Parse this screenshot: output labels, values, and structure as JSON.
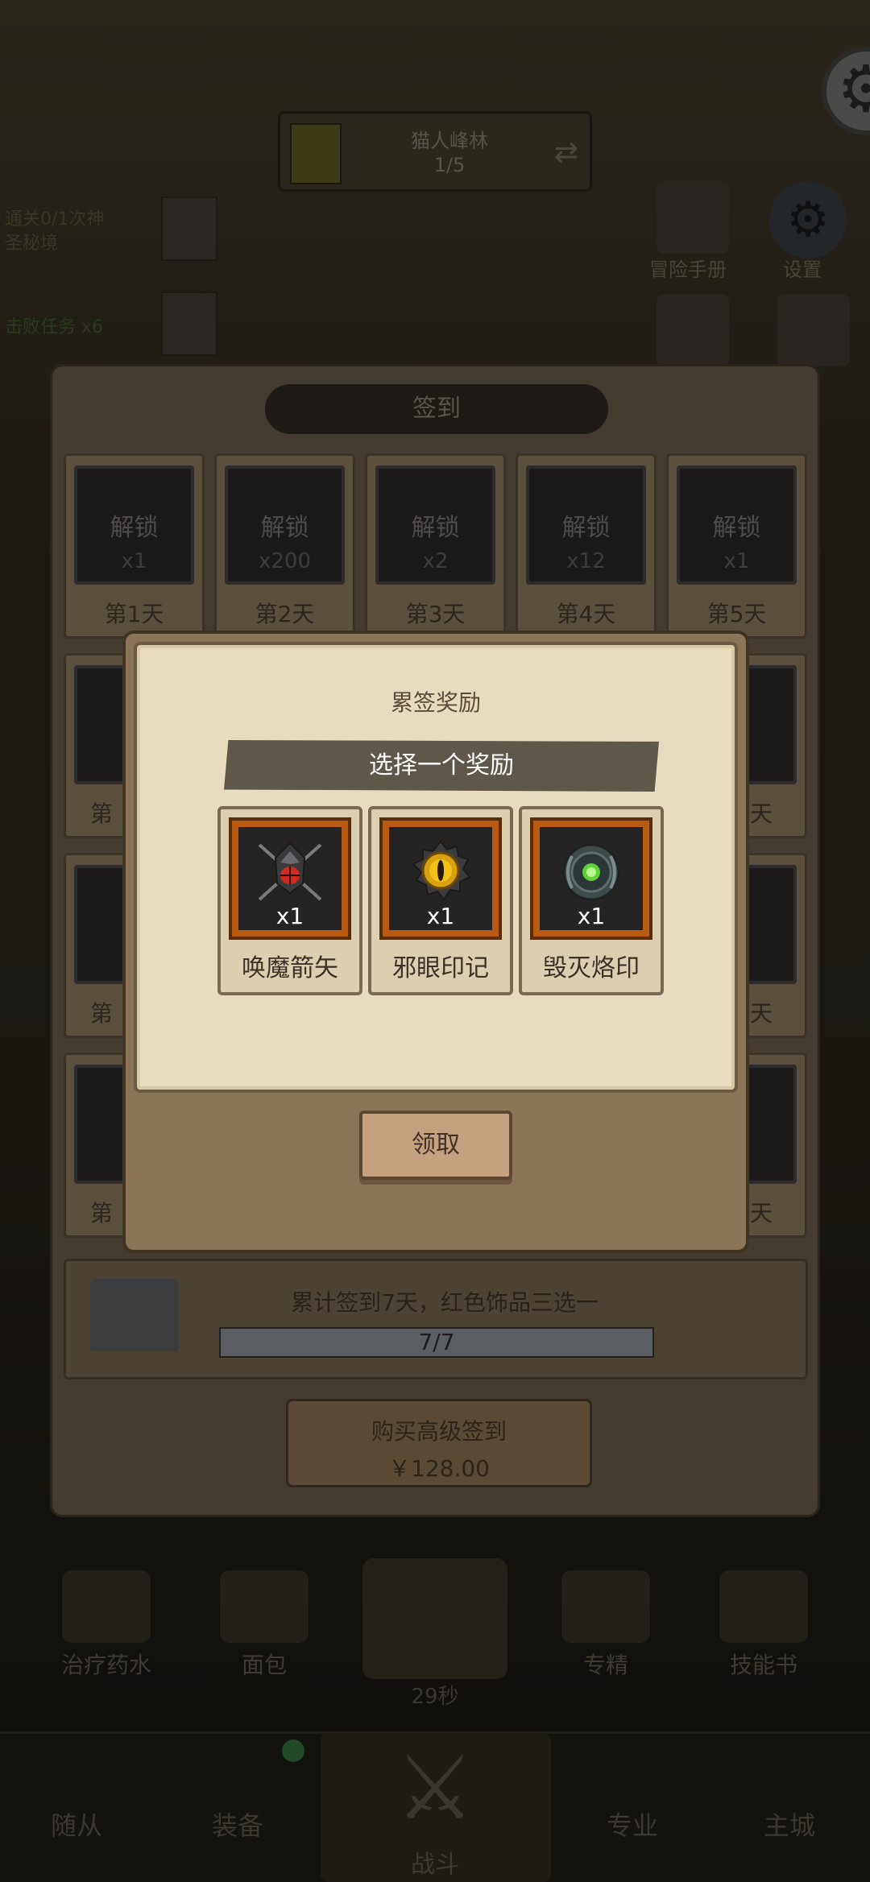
{
  "stage": {
    "name": "猫人峰林",
    "progress": "1/5"
  },
  "quest": {
    "line1": "通关0/1次神",
    "line2": "圣秘境",
    "line3": "击败任务 x6"
  },
  "side_labels": {
    "handbook": "冒险手册",
    "settings": "设置"
  },
  "signin": {
    "title": "签到",
    "lock_label": "解锁",
    "days": [
      {
        "count": "x1",
        "name": "第1天"
      },
      {
        "count": "x200",
        "name": "第2天"
      },
      {
        "count": "x2",
        "name": "第3天"
      },
      {
        "count": "x12",
        "name": "第4天"
      },
      {
        "count": "x1",
        "name": "第5天"
      }
    ],
    "partial_left": [
      "第",
      "第",
      "第"
    ],
    "partial_right": [
      "天",
      "天",
      "天"
    ],
    "cumulative_text": "累计签到7天，红色饰品三选一",
    "cumulative_progress": "7/7",
    "cumulative_fraction": 1.0,
    "buy_label": "购买高级签到",
    "buy_price": "￥128.00"
  },
  "modal": {
    "title": "累签奖励",
    "banner": "选择一个奖励",
    "rewards": [
      {
        "name": "唤魔箭矢",
        "count": "x1",
        "icon": "demon-arrow-icon"
      },
      {
        "name": "邪眼印记",
        "count": "x1",
        "icon": "evil-eye-icon"
      },
      {
        "name": "毁灭烙印",
        "count": "x1",
        "icon": "destruction-brand-icon"
      }
    ],
    "claim_label": "领取"
  },
  "bottom_items": [
    {
      "name": "治疗药水"
    },
    {
      "name": "面包"
    },
    {
      "name": "专精"
    },
    {
      "name": "技能书"
    }
  ],
  "timer": "29秒",
  "nav": {
    "follower": "随从",
    "equipment": "装备",
    "battle": "战斗",
    "specialty": "专业",
    "city": "主城"
  }
}
